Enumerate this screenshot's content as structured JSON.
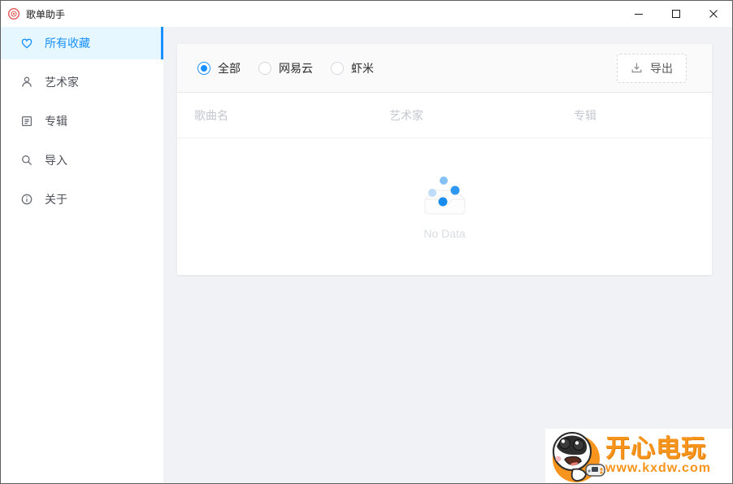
{
  "window": {
    "title": "歌单助手",
    "controls": {
      "minimize": "minimize",
      "maximize": "maximize",
      "close": "close"
    }
  },
  "sidebar": {
    "items": [
      {
        "label": "所有收藏",
        "icon": "heart-icon",
        "active": true
      },
      {
        "label": "艺术家",
        "icon": "user-icon",
        "active": false
      },
      {
        "label": "专辑",
        "icon": "album-icon",
        "active": false
      },
      {
        "label": "导入",
        "icon": "search-icon",
        "active": false
      },
      {
        "label": "关于",
        "icon": "info-icon",
        "active": false
      }
    ]
  },
  "toolbar": {
    "filters": [
      {
        "label": "全部",
        "selected": true
      },
      {
        "label": "网易云",
        "selected": false
      },
      {
        "label": "虾米",
        "selected": false
      }
    ],
    "export_label": "导出"
  },
  "table": {
    "columns": [
      "歌曲名",
      "艺术家",
      "专辑"
    ],
    "rows": [],
    "empty_text": "No Data"
  },
  "watermark": {
    "title": "开心电玩",
    "url": "www.kxdw.com"
  },
  "colors": {
    "accent": "#1890ff",
    "active_item_bg": "#e6f7ff",
    "main_bg": "#f0f2f5",
    "toolbar_bg": "#fafafa",
    "header_text": "#c3c7cf",
    "watermark_orange": "#f7941d",
    "app_icon_red": "#e25555"
  }
}
